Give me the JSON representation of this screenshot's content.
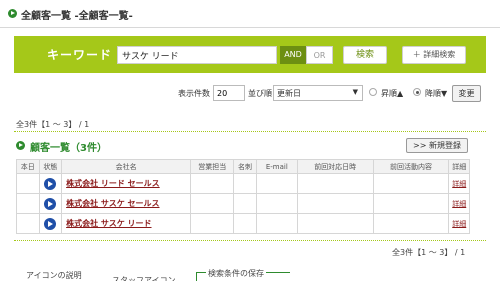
{
  "header": {
    "title": "全顧客一覧 -全顧客一覧-"
  },
  "search": {
    "label": "キーワード",
    "keyword": "サスケ リード",
    "and_label": "AND",
    "or_label": "OR",
    "search_button": "検索",
    "detail_button": "＋ 詳細検索"
  },
  "controls": {
    "count_label": "表示件数",
    "count_value": "20",
    "sort_label": "並び順",
    "sort_value": "更新日",
    "asc_label": "昇順▲",
    "desc_label": "降順▼",
    "change_button": "変更"
  },
  "summary_top": "全3件【1 〜 3】 / 1",
  "list": {
    "heading": "顧客一覧（3件）",
    "new_button": ">> 新規登録",
    "columns": [
      "本日",
      "状態",
      "会社名",
      "営業担当",
      "名刺",
      "E-mail",
      "前回対応日時",
      "前回活動内容",
      "詳細"
    ],
    "rows": [
      {
        "company": "株式会社 リード セールス",
        "detail": "詳細"
      },
      {
        "company": "株式会社 サスケ セールス",
        "detail": "詳細"
      },
      {
        "company": "株式会社 サスケ リード",
        "detail": "詳細"
      }
    ]
  },
  "summary_bottom": "全3件【1 〜 3】 / 1",
  "bottom": {
    "icon_desc": "アイコンの説明",
    "staff_icon": "スタッフアイコン",
    "save_conditions": "検索条件の保存"
  },
  "colors": {
    "accent_green": "#a5c819",
    "dark_green": "#2e8b2e",
    "link_red": "#8b1a1a"
  }
}
